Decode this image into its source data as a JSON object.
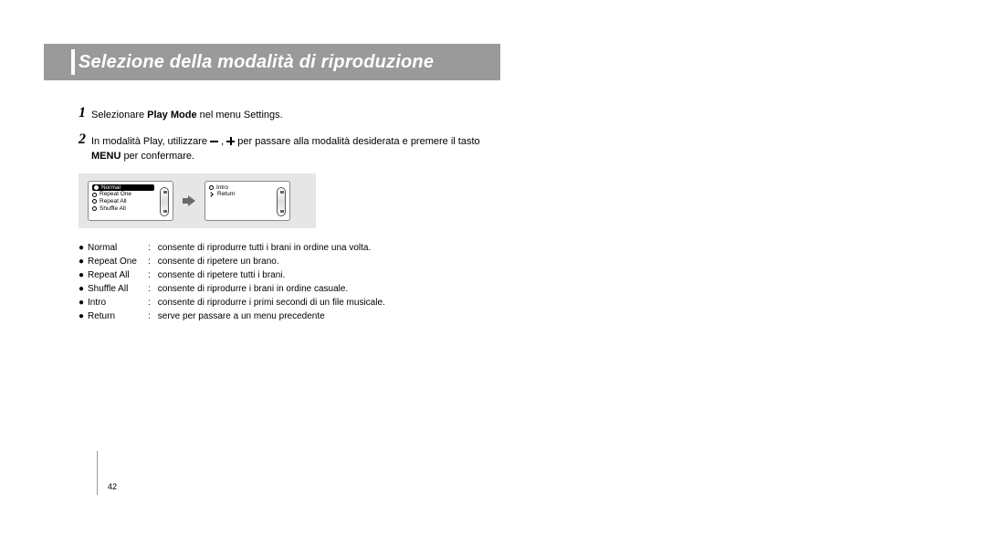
{
  "header": {
    "title": "Selezione della modalità di riproduzione"
  },
  "steps": {
    "s1": {
      "num": "1",
      "pre": "Selezionare ",
      "bold": "Play Mode",
      "post": " nel menu Settings."
    },
    "s2": {
      "num": "2",
      "pre": "In modalità Play, utilizzare ",
      "mid": " , ",
      "post1": " per passare alla modalità desiderata e premere il tasto ",
      "bold": "MENU",
      "post2": " per confermare."
    }
  },
  "device": {
    "left": {
      "items": [
        "Normal",
        "Repeat One",
        "Repeat All",
        "Shuffle All"
      ],
      "selectedIndex": 0
    },
    "right": {
      "items": [
        "Intro",
        "Return"
      ]
    }
  },
  "glossary": [
    {
      "term": "Normal",
      "desc": "consente di riprodurre tutti i brani in ordine una volta."
    },
    {
      "term": "Repeat One",
      "desc": "consente di ripetere un brano."
    },
    {
      "term": "Repeat All",
      "desc": "consente di ripetere tutti i brani."
    },
    {
      "term": "Shuffle All",
      "desc": "consente di riprodurre i brani in ordine casuale."
    },
    {
      "term": "Intro",
      "desc": "consente di riprodurre i primi secondi di un file musicale."
    },
    {
      "term": "Return",
      "desc": "serve per passare a un menu precedente"
    }
  ],
  "page": {
    "number": "42"
  }
}
